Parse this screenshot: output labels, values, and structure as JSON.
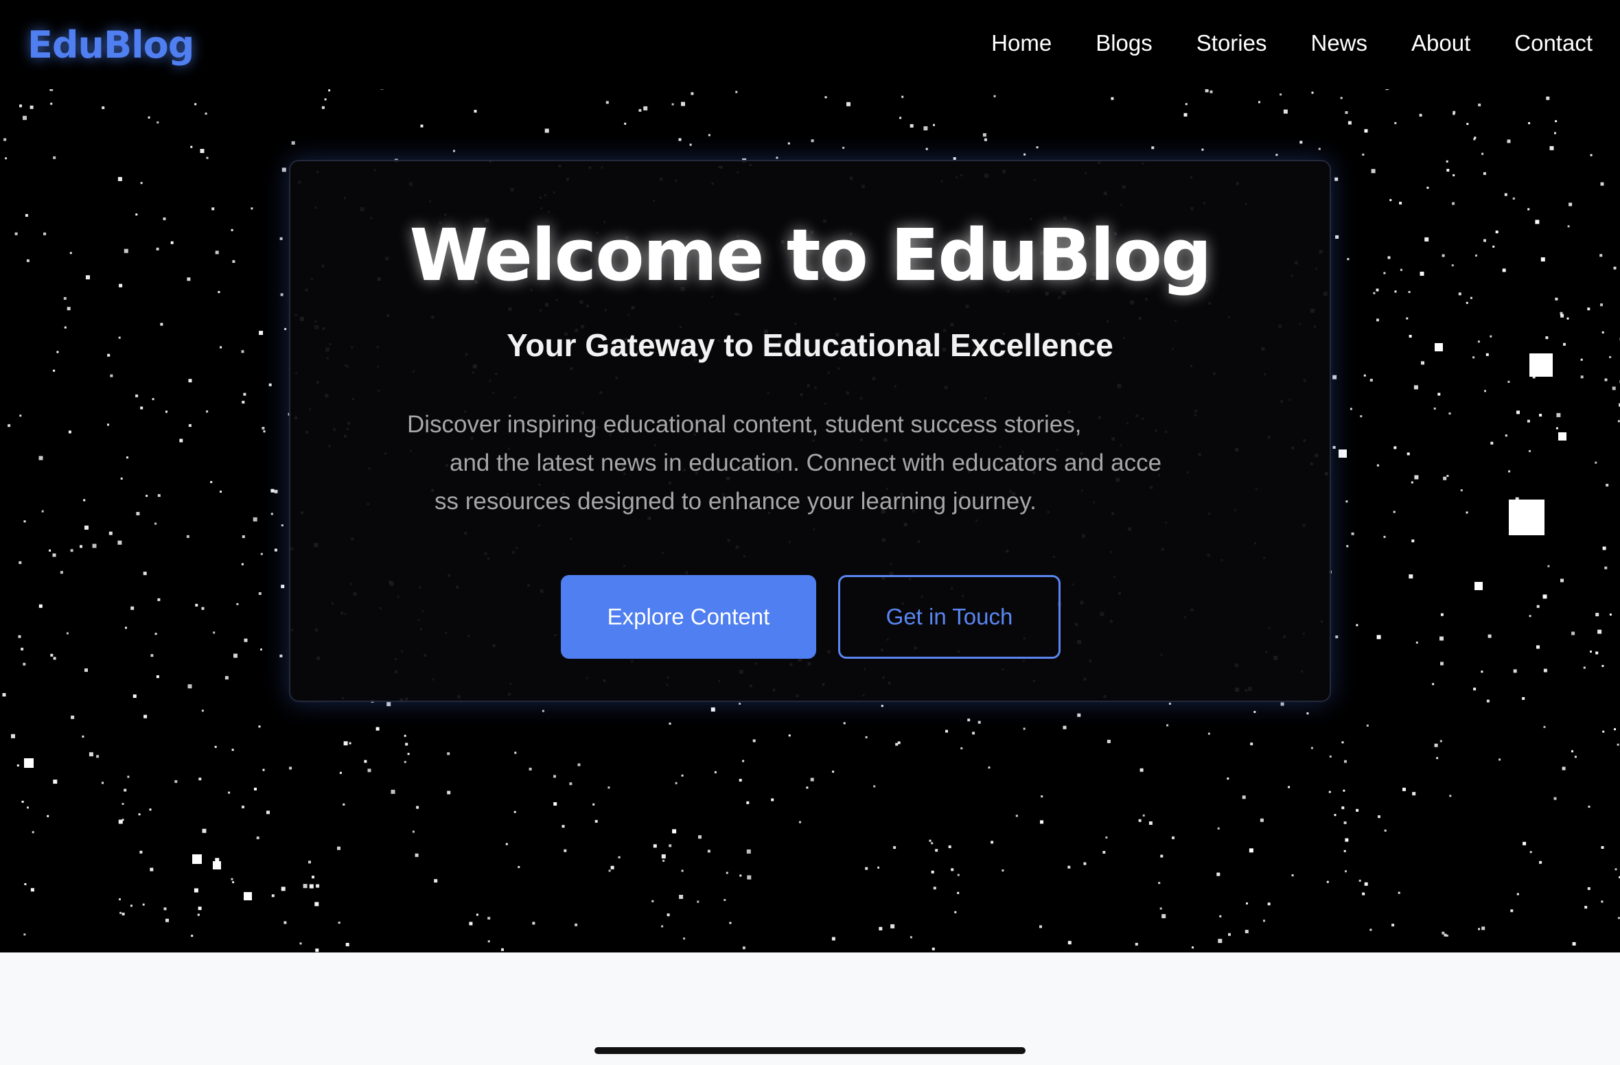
{
  "brand": {
    "name": "EduBlog",
    "accent_color": "#4f7ff0"
  },
  "nav": {
    "items": [
      {
        "label": "Home"
      },
      {
        "label": "Blogs"
      },
      {
        "label": "Stories"
      },
      {
        "label": "News"
      },
      {
        "label": "About"
      },
      {
        "label": "Contact"
      }
    ]
  },
  "hero": {
    "title": "Welcome to EduBlog",
    "subtitle": "Your Gateway to Educational Excellence",
    "description_lines": [
      "Discover inspiring educational content, student success stories,",
      "and the latest news in education. Connect with educators and acce",
      "ss resources designed to enhance your learning journey."
    ],
    "primary_button": "Explore Content",
    "secondary_button": "Get in Touch",
    "background": "starfield"
  },
  "colors": {
    "hero_background": "#000000",
    "primary_button": "#4f7ff0",
    "outline_button": "#5b86f2",
    "page_background": "#f8f9fb"
  }
}
